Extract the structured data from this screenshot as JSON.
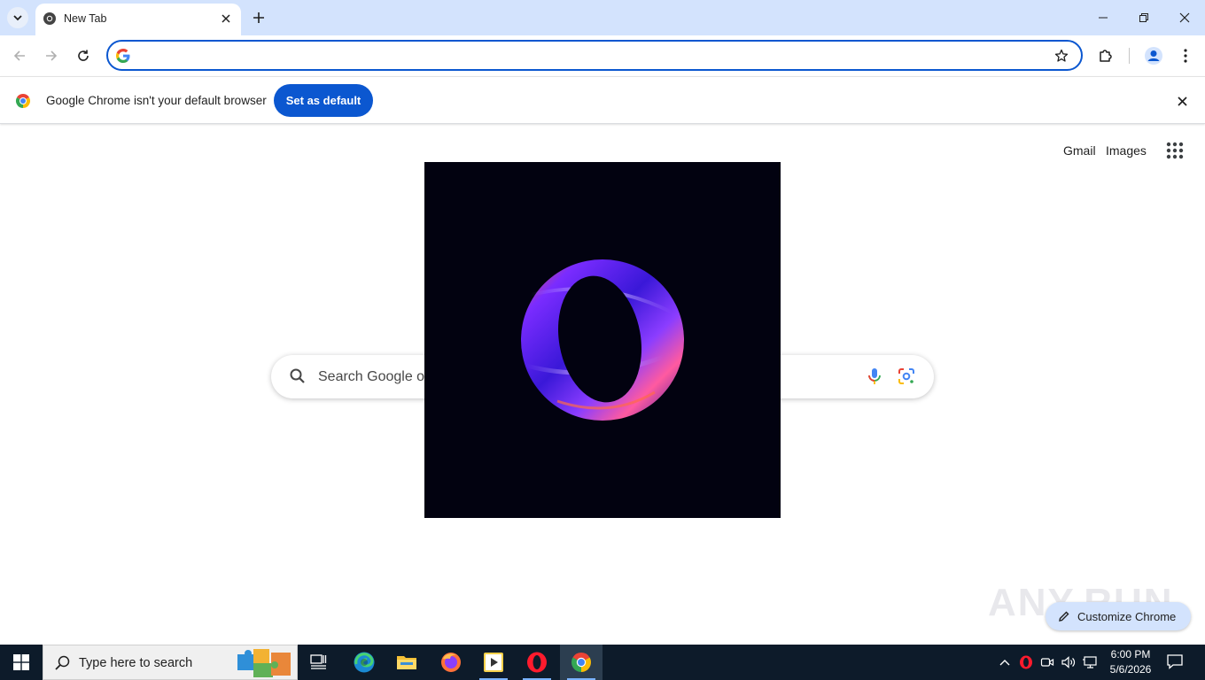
{
  "browser": {
    "tab": {
      "title": "New Tab"
    },
    "omnibox": {
      "value": "",
      "placeholder": ""
    }
  },
  "infobar": {
    "message": "Google Chrome isn't your default browser",
    "button_label": "Set as default"
  },
  "ntp": {
    "links": {
      "gmail": "Gmail",
      "images": "Images"
    },
    "search": {
      "placeholder": "Search Google or type a URL"
    },
    "customize_label": "Customize Chrome",
    "watermark": "ANY.RUN"
  },
  "taskbar": {
    "search_placeholder": "Type here to search",
    "apps": [
      "task-view",
      "edge",
      "file-explorer",
      "firefox",
      "media-player",
      "opera",
      "chrome"
    ],
    "clock": {
      "time": "6:00 PM",
      "date": "5/6/2026"
    }
  },
  "colors": {
    "tabstrip": "#d3e3fd",
    "accent": "#0b57d0",
    "taskbar": "#0d1b2a",
    "overlay": "#020210"
  }
}
